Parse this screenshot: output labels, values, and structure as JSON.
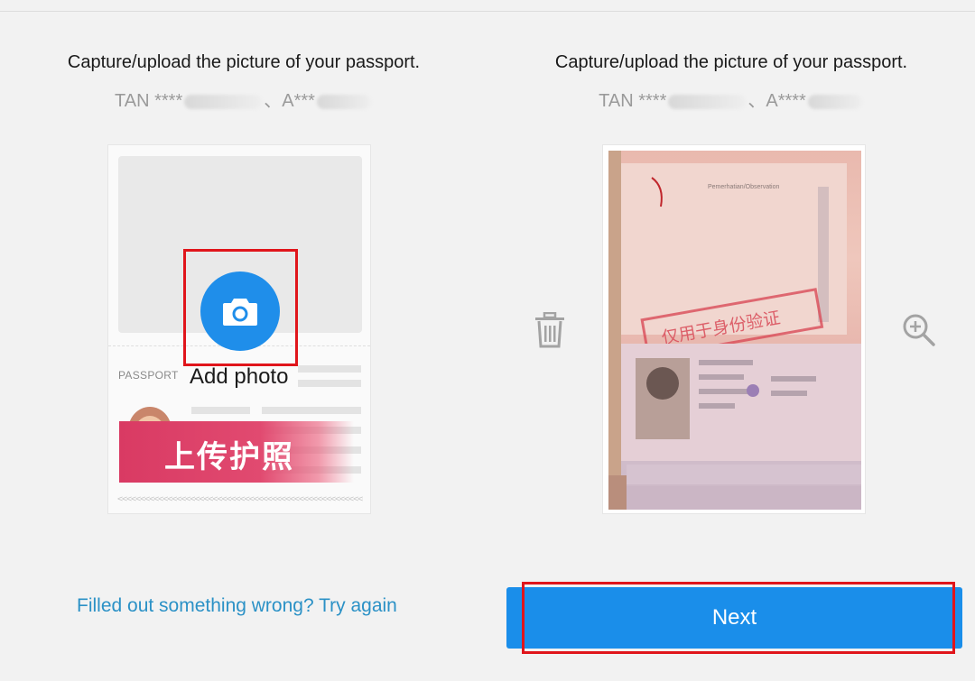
{
  "left": {
    "title": "Capture/upload the picture of your passport.",
    "name_prefix": "TAN ****",
    "name_sep": "、A***",
    "card": {
      "passport_label": "PASSPORT",
      "watermark": "上传护照",
      "mrz": "<<<<<<<<<<<<<<<<<<<<<<<<<<<<<<<<<<<<<<<<<<<<<<<<<<<<<<<<<<<<"
    },
    "camera_icon": "camera-icon",
    "add_photo_label": "Add photo",
    "retry_link": "Filled out something wrong? Try again"
  },
  "right": {
    "title": "Capture/upload the picture of your passport.",
    "name_prefix": "TAN ****",
    "name_sep": "、A****",
    "preview": {
      "page_heading": "Pemerhatian/Observation",
      "stamp_text": "仅用于身份验证"
    },
    "delete_icon": "trash-icon",
    "zoom_icon": "zoom-in-icon",
    "next_label": "Next"
  },
  "colors": {
    "primary": "#1a8eea",
    "link": "#2b91c6",
    "highlight": "#e0151b",
    "background": "#f2f2f2"
  }
}
